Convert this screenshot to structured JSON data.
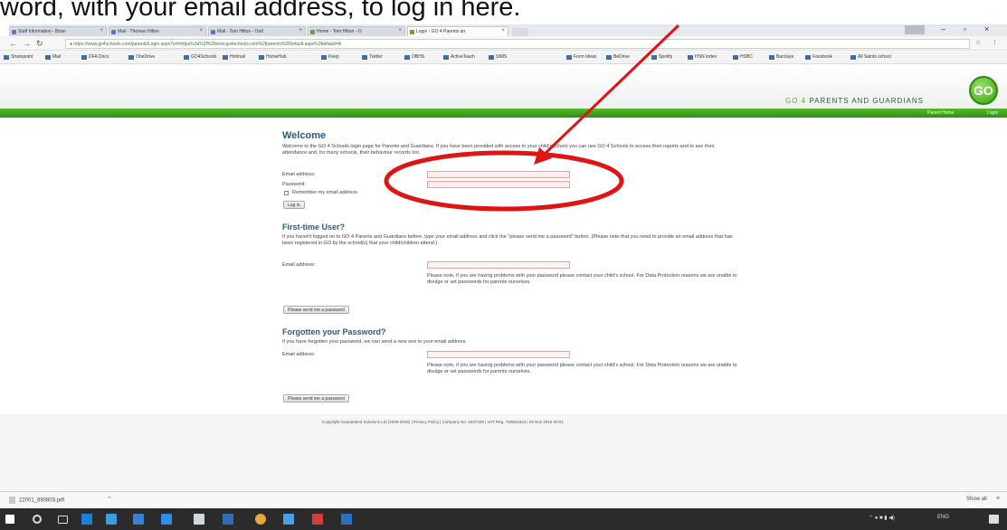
{
  "caption": "word, with your email address, to log in here.",
  "browser": {
    "tabs": [
      {
        "label": "Staff Information - Brian"
      },
      {
        "label": "Mail - Thomas Hilton"
      },
      {
        "label": "Mail - Tom Hilton - Outl"
      },
      {
        "label": "Home - Tom Hilton - O"
      },
      {
        "label": "Login - GO 4 Parents an"
      }
    ],
    "url": "https://www.go4schools.com/parents/Login.aspx?url=https%3a%2f%2fwww.go4schools.com%2fparents%2fDefault.aspx%3fdefault=A",
    "bookmarks": [
      "Sharepoint",
      "Mail",
      "DFA Docs",
      "OneDrive",
      "GO4Schools",
      "Hotmail",
      "HomeHub",
      "Keep",
      "Twitter",
      "OBHS",
      "ActiveTeach",
      "SIMS",
      "Form Ideas",
      "BeDrive",
      "Spotify",
      "HSN Index",
      "HSBC",
      "Barclays",
      "Facebook",
      "All Saints school"
    ]
  },
  "site": {
    "brand_go4": "GO 4",
    "brand_rest": " PARENTS AND GUARDIANS",
    "logo": "GO",
    "nav_links": [
      "Parent Home",
      "Login"
    ]
  },
  "welcome": {
    "title": "Welcome",
    "intro": "Welcome to the GO 4 Schools login page for Parents and Guardians. If you have been provided with access to your child's school you can use GO 4 Schools to access their reports and to see their attendance and, for many schools, their behaviour records too.",
    "email_label": "Email address:",
    "password_label": "Password:",
    "remember_label": "Remember my email address",
    "login_button": "Log in"
  },
  "first_time": {
    "title": "First-time User?",
    "text": "If you haven't logged on to GO 4 Parents and Guardians before, type your email address and click the \"please send me a password\" button. (Please note that you need to provide an email address that has been registered in GO by the school(s) that your child/children attend.)",
    "email_label": "Email address:",
    "note": "Please note, if you are having problems with your password please contact your child's school. For Data Protection reasons we are unable to divulge or set passwords for parents ourselves.",
    "button": "Please send me a password"
  },
  "forgotten": {
    "title": "Forgotten your Password?",
    "text": "If you have forgotten your password, we can send a new one to your email address.",
    "email_label": "Email address:",
    "note": "Please note, if you are having problems with your password please contact your child's school. For Data Protection reasons we are unable to divulge or set passwords for parents ourselves.",
    "button": "Please send me a password"
  },
  "footer": {
    "copyright": "Copyright Guaranteed Solutions Ltd (2009-2016) | Privacy Policy | Company No. 5447438 | VAT Reg. 750601823 | 29 Nov 2016 00:01"
  },
  "downloads": {
    "file": "22001_890803.pdf",
    "show_all": "Show all"
  },
  "taskbar": {
    "tray_text": "ENG"
  },
  "annotation_color": "#e01414"
}
